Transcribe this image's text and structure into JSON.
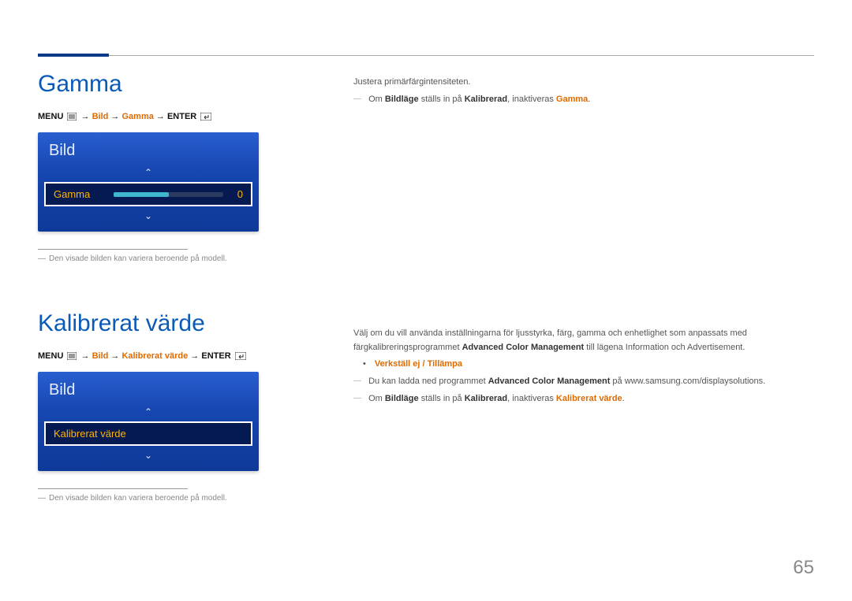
{
  "page_number": "65",
  "sections": {
    "gamma": {
      "title": "Gamma",
      "breadcrumb": {
        "menu": "MENU",
        "path1": "Bild",
        "path2": "Gamma",
        "enter": "ENTER"
      },
      "osd": {
        "panel_title": "Bild",
        "row_label": "Gamma",
        "row_value": "0"
      },
      "caption_prefix": "―",
      "caption": "Den visade bilden kan variera beroende på modell.",
      "right": {
        "line1": "Justera primärfärgintensiteten.",
        "note_prefix": "Om ",
        "note_bold1": "Bildläge",
        "note_mid": " ställs in på ",
        "note_bold2": "Kalibrerad",
        "note_mid2": ", inaktiveras ",
        "note_orange": "Gamma",
        "note_end": "."
      }
    },
    "kalibrerat": {
      "title": "Kalibrerat värde",
      "breadcrumb": {
        "menu": "MENU",
        "path1": "Bild",
        "path2": "Kalibrerat värde",
        "enter": "ENTER"
      },
      "osd": {
        "panel_title": "Bild",
        "row_label": "Kalibrerat värde"
      },
      "caption_prefix": "―",
      "caption": "Den visade bilden kan variera beroende på modell.",
      "right": {
        "para1a": "Välj om du vill använda inställningarna för ljusstyrka, färg, gamma och enhetlighet som anpassats med färgkalibreringsprogrammet ",
        "para1b": "Advanced Color Management",
        "para1c": " till lägena Information och Advertisement.",
        "bullet_orange": "Verkställ ej / Tillämpa",
        "note2a": "Du kan ladda ned programmet ",
        "note2b": "Advanced Color Management",
        "note2c": " på www.samsung.com/displaysolutions.",
        "note3_prefix": "Om ",
        "note3_bold1": "Bildläge",
        "note3_mid": " ställs in på ",
        "note3_bold2": "Kalibrerad",
        "note3_mid2": ", inaktiveras ",
        "note3_orange": "Kalibrerat värde",
        "note3_end": "."
      }
    }
  }
}
